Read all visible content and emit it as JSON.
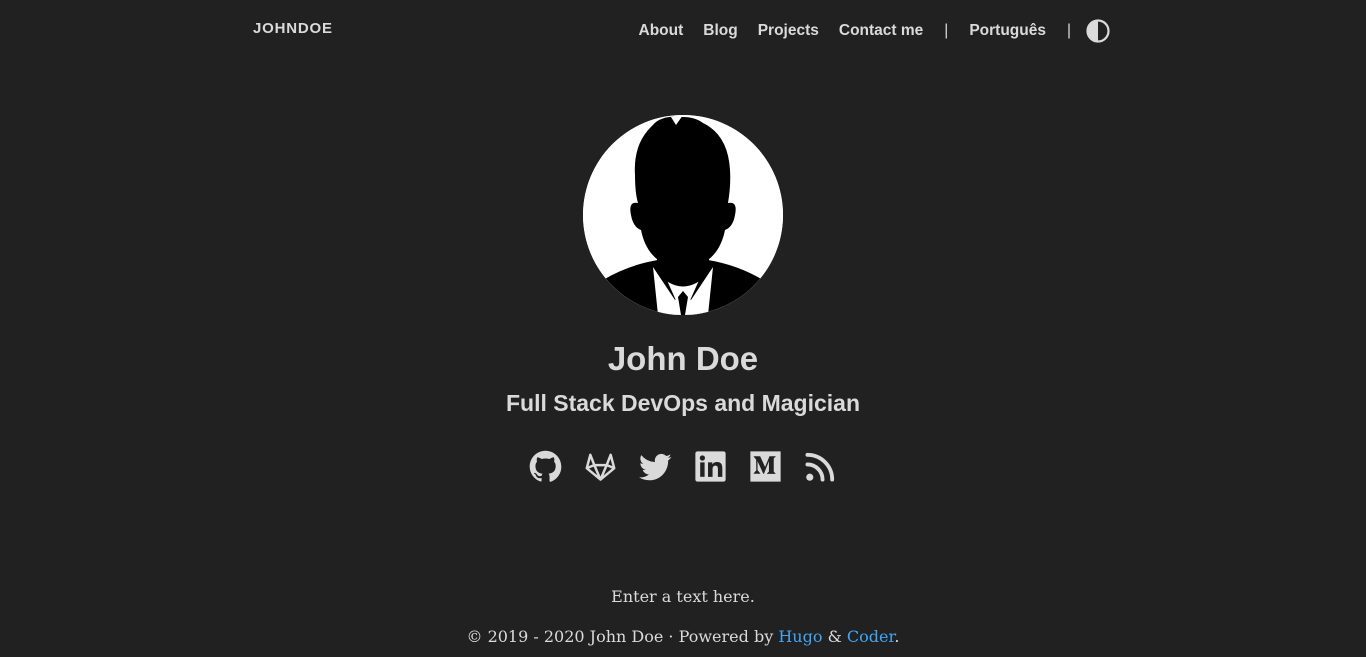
{
  "nav": {
    "brand": "JOHNDOE",
    "links": [
      "About",
      "Blog",
      "Projects",
      "Contact me"
    ],
    "separator": "|",
    "language": "Português",
    "theme_toggle_icon": "half-circle-contrast-icon"
  },
  "profile": {
    "avatar_icon": "person-silhouette-avatar",
    "name": "John Doe",
    "tagline": "Full Stack DevOps and Magician"
  },
  "social": {
    "icons": [
      "github-icon",
      "gitlab-icon",
      "twitter-icon",
      "linkedin-icon",
      "medium-icon",
      "rss-icon"
    ]
  },
  "footer": {
    "text": "Enter a text here.",
    "copyright": "© 2019 - 2020 John Doe",
    "dot": " · ",
    "powered_by": "Powered by",
    "hugo": "Hugo",
    "amp": "&",
    "coder": "Coder",
    "period": "."
  },
  "colors": {
    "background": "#212121",
    "text": "#dadada",
    "link": "#42a5f5"
  }
}
